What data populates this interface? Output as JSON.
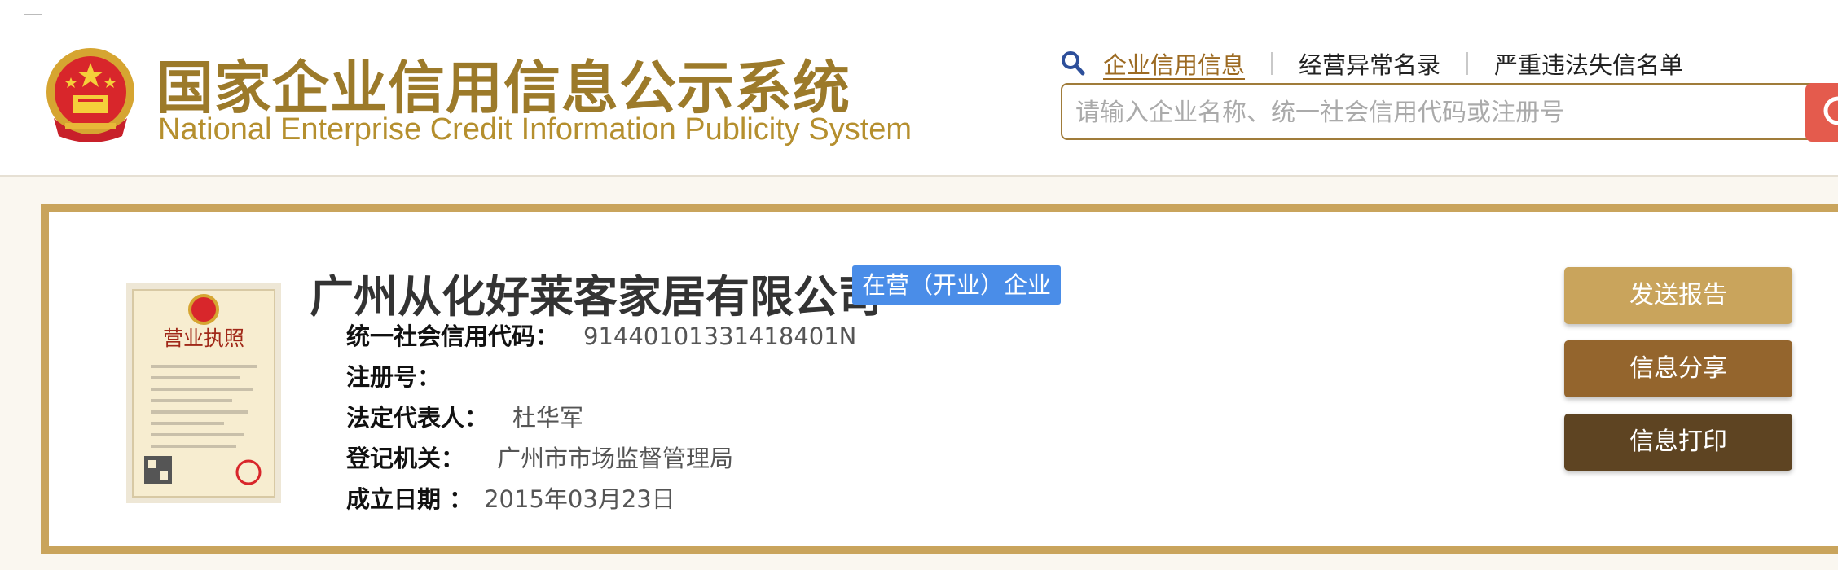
{
  "logo": {
    "title_cn": "国家企业信用信息公示系统",
    "title_en": "National Enterprise Credit Information Publicity System"
  },
  "nav": {
    "items": [
      {
        "label": "企业信用信息",
        "active": true
      },
      {
        "label": "经营异常名录",
        "active": false
      },
      {
        "label": "严重违法失信名单",
        "active": false
      }
    ]
  },
  "search": {
    "placeholder": "请输入企业名称、统一社会信用代码或注册号",
    "value": ""
  },
  "company": {
    "name": "广州从化好莱客家居有限公司",
    "status": "在营（开业）企业",
    "license_image_heading": "营业执照",
    "fields": [
      {
        "label": "统一社会信用代码：",
        "value": "91440101331418401N"
      },
      {
        "label": "注册号：",
        "value": ""
      },
      {
        "label": "法定代表人：",
        "value": "杜华军"
      },
      {
        "label": "登记机关：",
        "value": "广州市市场监督管理局"
      },
      {
        "label": "成立日期 ：",
        "value": "2015年03月23日"
      }
    ]
  },
  "actions": {
    "send_report": "发送报告",
    "share": "信息分享",
    "print": "信息打印"
  },
  "colors": {
    "gold": "#c9a45c",
    "brown": "#94652d",
    "dark_brown": "#5e4422",
    "status_blue": "#4a8de8",
    "search_red": "#e45b4d"
  },
  "icons": {
    "emblem": "national-emblem",
    "search": "magnifier"
  }
}
